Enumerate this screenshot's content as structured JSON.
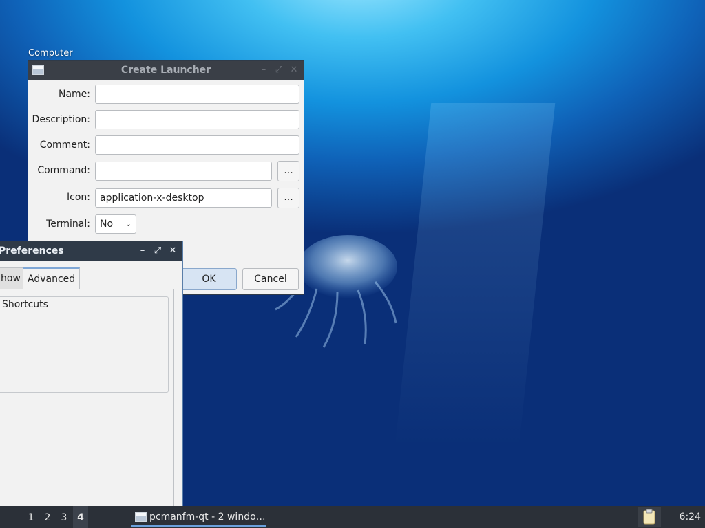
{
  "desktop": {
    "icon_label": "Computer"
  },
  "launcher_dialog": {
    "title": "Create Launcher",
    "fields": {
      "name": {
        "label": "Name:",
        "value": ""
      },
      "description": {
        "label": "Description:",
        "value": ""
      },
      "comment": {
        "label": "Comment:",
        "value": ""
      },
      "command": {
        "label": "Command:",
        "value": ""
      },
      "icon": {
        "label": "Icon:",
        "value": "application-x-desktop"
      },
      "terminal": {
        "label": "Terminal:",
        "value": "No"
      }
    },
    "browse_label": "...",
    "ok_label": "OK",
    "cancel_label": "Cancel"
  },
  "preferences_dialog": {
    "title": "Preferences",
    "tabs": [
      {
        "label": "how"
      },
      {
        "label": "Advanced"
      }
    ],
    "group_title": "Shortcuts"
  },
  "taskbar": {
    "desktops": [
      "1",
      "2",
      "3",
      "4"
    ],
    "active_desktop": "4",
    "task_label": "pcmanfm-qt - 2 windo…",
    "clock": "6:24"
  },
  "colors": {
    "titlebar": "#3a3f47",
    "taskbar": "#2b3038",
    "accent": "#6aa0dc"
  },
  "icons": {
    "window_app": "window-icon",
    "minimize": "minimize-icon",
    "maximize": "maximize-icon",
    "close": "close-icon",
    "clipboard": "clipboard-icon"
  }
}
